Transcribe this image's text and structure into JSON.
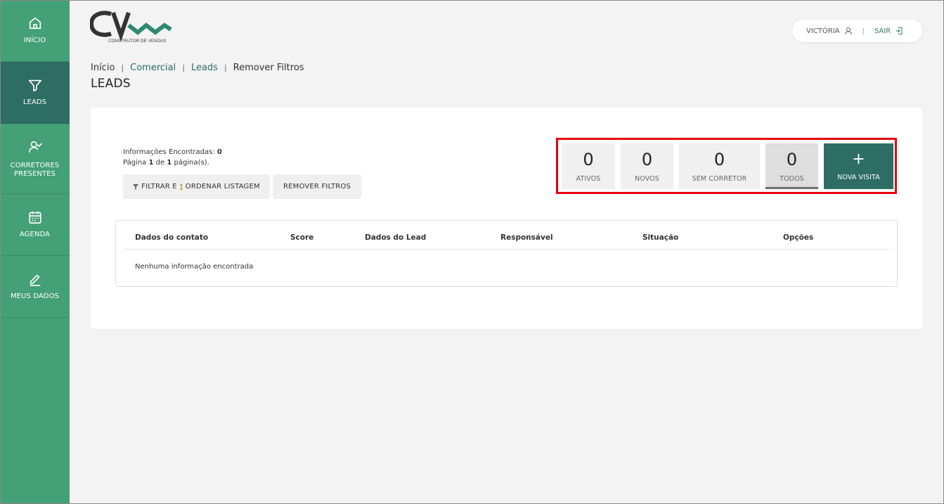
{
  "sidebar": {
    "items": [
      {
        "label": "INÍCIO",
        "icon": "home-icon",
        "active": false
      },
      {
        "label": "LEADS",
        "icon": "funnel-icon",
        "active": true
      },
      {
        "label": "CORRETORES PRESENTES",
        "icon": "user-check-icon",
        "active": false
      },
      {
        "label": "AGENDA",
        "icon": "calendar-icon",
        "active": false
      },
      {
        "label": "MEUS DADOS",
        "icon": "pencil-icon",
        "active": false
      }
    ]
  },
  "header": {
    "logo_subtitle": "CONSTRUTOR DE VENDAS",
    "user_name": "VICTÓRIA",
    "separator": "|",
    "logout_label": "SAIR"
  },
  "breadcrumb": {
    "items": [
      "Início",
      "Comercial",
      "Leads",
      "Remover Filtros"
    ],
    "separator": "|"
  },
  "page_title": "LEADS",
  "summary": {
    "found_label": "Informações Encontradas:",
    "found_count": "0",
    "page_prefix": "Página",
    "page_current": "1",
    "page_of": "de",
    "page_total": "1",
    "page_suffix": "página(s)."
  },
  "buttons": {
    "filter_part1": "FILTRAR E",
    "filter_part2": "ORDENAR LISTAGEM",
    "remove_filters": "REMOVER FILTROS"
  },
  "stats": [
    {
      "value": "0",
      "label": "ATIVOS"
    },
    {
      "value": "0",
      "label": "NOVOS"
    },
    {
      "value": "0",
      "label": "SEM CORRETOR"
    },
    {
      "value": "0",
      "label": "TODOS"
    }
  ],
  "nova_visita": {
    "symbol": "+",
    "label": "NOVA VISITA"
  },
  "table": {
    "columns": [
      "Dados do contato",
      "Score",
      "Dados do Lead",
      "Responsável",
      "Situação",
      "Opções"
    ],
    "empty_message": "Nenhuma informação encontrada"
  },
  "colors": {
    "sidebar": "#44a076",
    "sidebar_active": "#2e6d63",
    "accent": "#2e6d63",
    "highlight": "#e8000d"
  }
}
